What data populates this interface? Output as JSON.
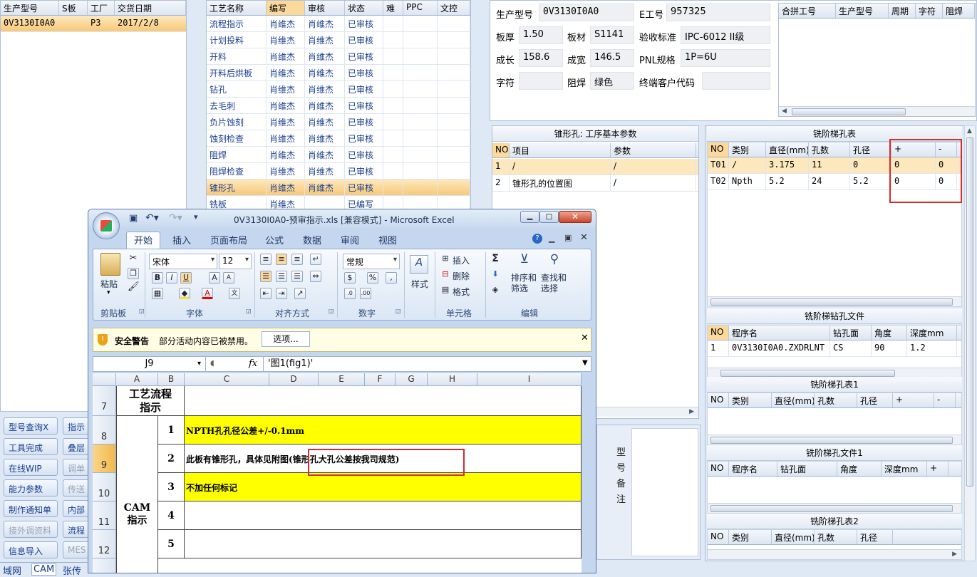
{
  "left_table": {
    "headers": [
      "生产型号",
      "S板",
      "工厂",
      "交货日期"
    ],
    "rows": [
      [
        "0V3130I0A0",
        "",
        "P3",
        "2017/2/8"
      ]
    ]
  },
  "process_table": {
    "headers": [
      "工艺名称",
      "编写",
      "审核",
      "状态",
      "难",
      "PPC",
      "文控"
    ],
    "rows": [
      [
        "流程指示",
        "肖维杰",
        "肖维杰",
        "已审核"
      ],
      [
        "计划投料",
        "肖维杰",
        "肖维杰",
        "已审核"
      ],
      [
        "开料",
        "肖维杰",
        "肖维杰",
        "已审核"
      ],
      [
        "开料后烘板",
        "肖维杰",
        "肖维杰",
        "已审核"
      ],
      [
        "钻孔",
        "肖维杰",
        "肖维杰",
        "已审核"
      ],
      [
        "去毛刺",
        "肖维杰",
        "肖维杰",
        "已审核"
      ],
      [
        "负片蚀刻",
        "肖维杰",
        "肖维杰",
        "已审核"
      ],
      [
        "蚀刻检查",
        "肖维杰",
        "肖维杰",
        "已审核"
      ],
      [
        "阻焊",
        "肖维杰",
        "肖维杰",
        "已审核"
      ],
      [
        "阻焊检查",
        "肖维杰",
        "肖维杰",
        "已审核"
      ],
      [
        "锥形孔",
        "肖维杰",
        "肖维杰",
        "已审核"
      ],
      [
        "铣板",
        "肖维杰",
        "",
        "已编写"
      ]
    ],
    "selected_index": 10
  },
  "info": {
    "prod_model_label": "生产型号",
    "prod_model": "0V3130I0A0",
    "e_no_label": "E工号",
    "e_no": "957325",
    "thickness_label": "板厚",
    "thickness": "1.50",
    "material_label": "板材",
    "material": "S1141",
    "standard_label": "验收标准",
    "standard": "IPC-6012 II级",
    "length_label": "成长",
    "length": "158.6",
    "width_label": "成宽",
    "width": "146.5",
    "pnl_label": "PNL规格",
    "pnl": "1P=6U",
    "char_label": "字符",
    "char": "",
    "mask_label": "阻焊",
    "mask": "绿色",
    "customer_label": "终端客户代码",
    "customer": ""
  },
  "combine_table": {
    "headers": [
      "合拼工号",
      "生产型号",
      "周期",
      "字符",
      "阻焊"
    ]
  },
  "cone_params": {
    "title": "锥形孔: 工序基本参数",
    "headers": [
      "NO",
      "项目",
      "参数"
    ],
    "rows": [
      [
        "1",
        "/",
        "/"
      ],
      [
        "2",
        "锥形孔的位置图",
        "/"
      ]
    ]
  },
  "step_hole": {
    "title": "铣阶梯孔表",
    "headers": [
      "NO",
      "类别",
      "直径(mm)",
      "孔数",
      "孔径",
      "+",
      "-"
    ],
    "rows": [
      [
        "T01",
        "/",
        "3.175",
        "11",
        "0",
        "0",
        "0"
      ],
      [
        "T02",
        "Npth",
        "5.2",
        "24",
        "5.2",
        "0",
        "0"
      ]
    ]
  },
  "step_drill": {
    "title": "铣阶梯钻孔文件",
    "headers": [
      "NO",
      "程序名",
      "钻孔面",
      "角度",
      "深度mm"
    ],
    "rows": [
      [
        "1",
        "0V3130I0A0.ZXDRLNT",
        "CS",
        "90",
        "1.2"
      ]
    ]
  },
  "step_hole1": {
    "title": "铣阶梯孔表1",
    "headers": [
      "NO",
      "类别",
      "直径(mm)",
      "孔数",
      "孔径",
      "+",
      "-"
    ]
  },
  "step_drill1": {
    "title": "铣阶梯孔文件1",
    "headers": [
      "NO",
      "程序名",
      "钻孔面",
      "角度",
      "深度mm",
      "+"
    ]
  },
  "step_hole2": {
    "title": "铣阶梯孔表2",
    "headers": [
      "NO",
      "类别",
      "直径(mm)",
      "孔数",
      "孔径"
    ]
  },
  "model_note": {
    "label": "型号备注"
  },
  "left_buttons": [
    [
      "型号查询X",
      "指示"
    ],
    [
      "工具完成",
      "叠层"
    ],
    [
      "在线WIP",
      "调单"
    ],
    [
      "能力参数",
      "传送"
    ],
    [
      "制作通知单",
      "内部"
    ],
    [
      "接外调资料",
      "流程"
    ],
    [
      "信息导入",
      "MES"
    ]
  ],
  "bottom_tabs": [
    "域网",
    "CAM",
    "张传"
  ],
  "excel": {
    "title": "0V3130I0A0-预审指示.xls  [兼容模式] - Microsoft Excel",
    "tabs": [
      "开始",
      "插入",
      "页面布局",
      "公式",
      "数据",
      "审阅",
      "视图"
    ],
    "groups": [
      "剪贴板",
      "字体",
      "对齐方式",
      "数字",
      "单元格",
      "编辑"
    ],
    "paste": "粘贴",
    "font": "宋体",
    "font_size": "12",
    "number_format": "常规",
    "style": "样式",
    "insert": "插入",
    "delete": "删除",
    "format": "格式",
    "sort": "排序和\n筛选",
    "find": "查找和\n选择",
    "security_title": "安全警告",
    "security_text": "部分活动内容已被禁用。",
    "options": "选项...",
    "cell_ref": "J9",
    "fx": "fx",
    "formula": "'图1(fig1)'",
    "columns": [
      "A",
      "B",
      "C",
      "D",
      "E",
      "F",
      "G",
      "H",
      "I"
    ],
    "row_numbers": [
      "7",
      "8",
      "9",
      "10",
      "11",
      "12"
    ],
    "header_cell": "工艺流程\n指示",
    "cam_cell": "CAM\n指示",
    "items": [
      {
        "no": "1",
        "text": "NPTH孔孔径公差+/-0.1mm",
        "extra": ""
      },
      {
        "no": "2",
        "text": "此板有锥形孔，具体见附图",
        "extra": "(锥形孔大孔公差按我司规范)"
      },
      {
        "no": "3",
        "text": "不加任何标记",
        "extra": ""
      },
      {
        "no": "4",
        "text": "",
        "extra": ""
      },
      {
        "no": "5",
        "text": "",
        "extra": ""
      }
    ]
  }
}
